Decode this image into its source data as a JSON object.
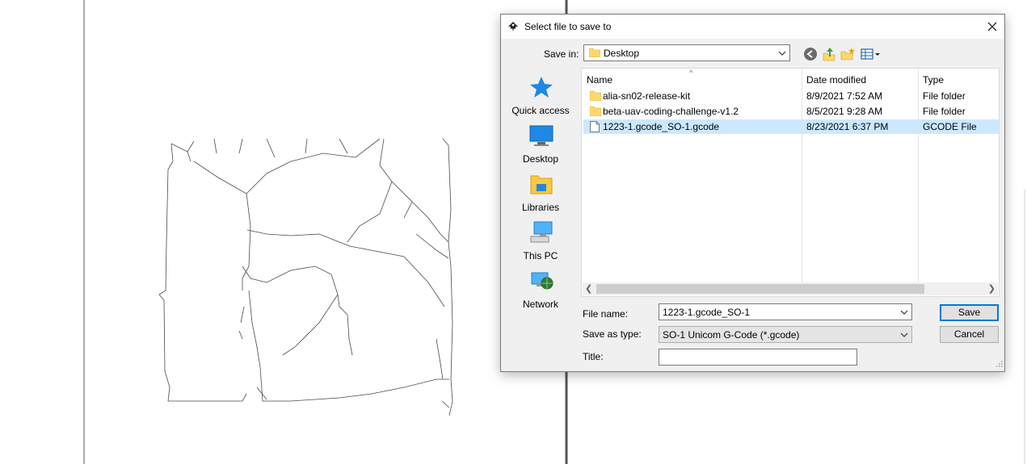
{
  "dialog": {
    "title": "Select file to save to",
    "close_icon": "close-icon",
    "save_in_label": "Save in:",
    "save_in_value": "Desktop",
    "toolbar": [
      "back-icon",
      "up-folder-icon",
      "new-folder-icon",
      "view-menu-icon"
    ],
    "places": [
      {
        "label": "Quick access",
        "icon": "star-icon"
      },
      {
        "label": "Desktop",
        "icon": "desktop-icon"
      },
      {
        "label": "Libraries",
        "icon": "libraries-icon"
      },
      {
        "label": "This PC",
        "icon": "computer-icon"
      },
      {
        "label": "Network",
        "icon": "network-icon"
      }
    ],
    "columns": {
      "name": "Name",
      "date": "Date modified",
      "type": "Type"
    },
    "files": [
      {
        "name": "alia-sn02-release-kit",
        "date": "8/9/2021 7:52 AM",
        "type": "File folder",
        "icon": "folder-icon"
      },
      {
        "name": "beta-uav-coding-challenge-v1.2",
        "date": "8/5/2021 9:28 AM",
        "type": "File folder",
        "icon": "folder-icon"
      },
      {
        "name": "1223-1.gcode_SO-1.gcode",
        "date": "8/23/2021 6:37 PM",
        "type": "GCODE File",
        "icon": "file-icon",
        "selected": true
      }
    ],
    "file_name_label": "File name:",
    "file_name_value": "1223-1.gcode_SO-1",
    "save_as_type_label": "Save as type:",
    "save_as_type_value": "SO-1 Unicom G-Code (*.gcode)",
    "title_label": "Title:",
    "title_value": "",
    "save_button": "Save",
    "cancel_button": "Cancel"
  },
  "colors": {
    "selection": "#cce8ff",
    "accent": "#0078d7",
    "folder": "#ffd86a",
    "dialog_bg": "#f0f0f0"
  }
}
